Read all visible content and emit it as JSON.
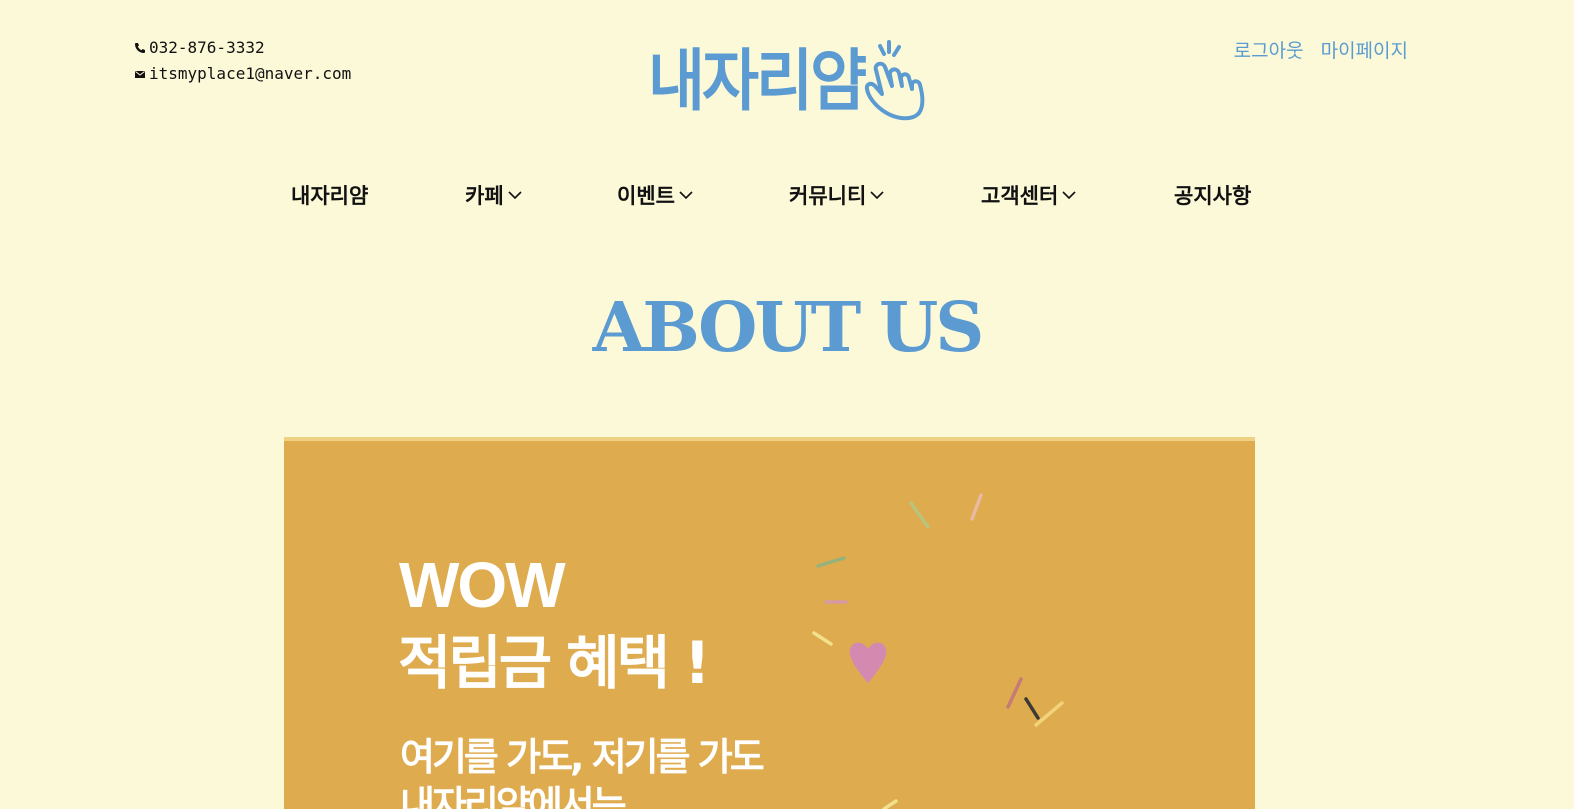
{
  "header": {
    "phone": "032-876-3332",
    "email": "itsmyplace1@naver.com",
    "logo_text": "내자리얌",
    "user_links": [
      "로그아웃",
      "마이페이지"
    ]
  },
  "nav": [
    {
      "label": "내자리얌",
      "dropdown": false
    },
    {
      "label": "카페",
      "dropdown": true
    },
    {
      "label": "이벤트",
      "dropdown": true
    },
    {
      "label": "커뮤니티",
      "dropdown": true
    },
    {
      "label": "고객센터",
      "dropdown": true
    },
    {
      "label": "공지사항",
      "dropdown": false
    }
  ],
  "main": {
    "title": "ABOUT US",
    "banner": {
      "headline": "WOW",
      "subheadline": "적립금 혜택 !",
      "line1": "여기를 가도, 저기를 가도",
      "line2": "내자리얌에서는"
    }
  },
  "colors": {
    "background": "#fcf9d8",
    "accent_blue": "#5b9bd1",
    "banner": "#deab4f",
    "heart": "#d48ab0"
  }
}
